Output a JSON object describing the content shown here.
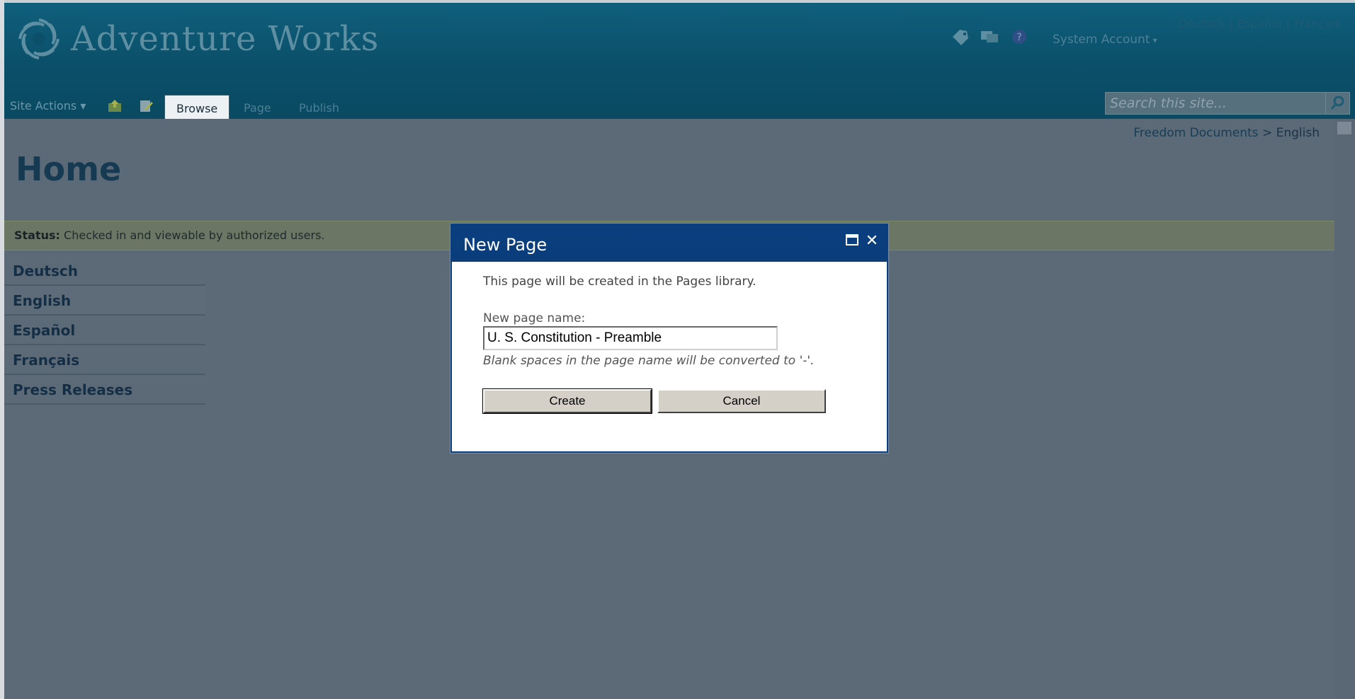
{
  "header": {
    "brand": "Adventure Works",
    "language_links": [
      "Deutsch",
      "Español",
      "Français"
    ],
    "account": "System Account",
    "icons": [
      "tag-icon",
      "notes-icon",
      "help-icon"
    ]
  },
  "nav": {
    "site_actions": "Site Actions",
    "tabs": [
      {
        "label": "Browse",
        "active": true
      },
      {
        "label": "Page",
        "active": false
      },
      {
        "label": "Publish",
        "active": false
      }
    ],
    "search_placeholder": "Search this site..."
  },
  "breadcrumb": {
    "parent": "Freedom Documents",
    "separator": ">",
    "current": "English"
  },
  "page": {
    "title": "Home",
    "status_label": "Status:",
    "status_text": "Checked in and viewable by authorized users."
  },
  "leftnav": {
    "items": [
      {
        "label": "Deutsch"
      },
      {
        "label": "English",
        "selected": true
      },
      {
        "label": "Español"
      },
      {
        "label": "Français"
      },
      {
        "label": "Press Releases"
      }
    ]
  },
  "dialog": {
    "title": "New Page",
    "message": "This page will be created in the Pages library.",
    "field_label": "New page name:",
    "field_value": "U. S. Constitution - Preamble",
    "hint": "Blank spaces in the page name will be converted to '-'.",
    "create_label": "Create",
    "cancel_label": "Cancel"
  },
  "colors": {
    "header": "#0b4f69",
    "dialog_title": "#0b3e7f",
    "overlay": "#5c6a78"
  }
}
